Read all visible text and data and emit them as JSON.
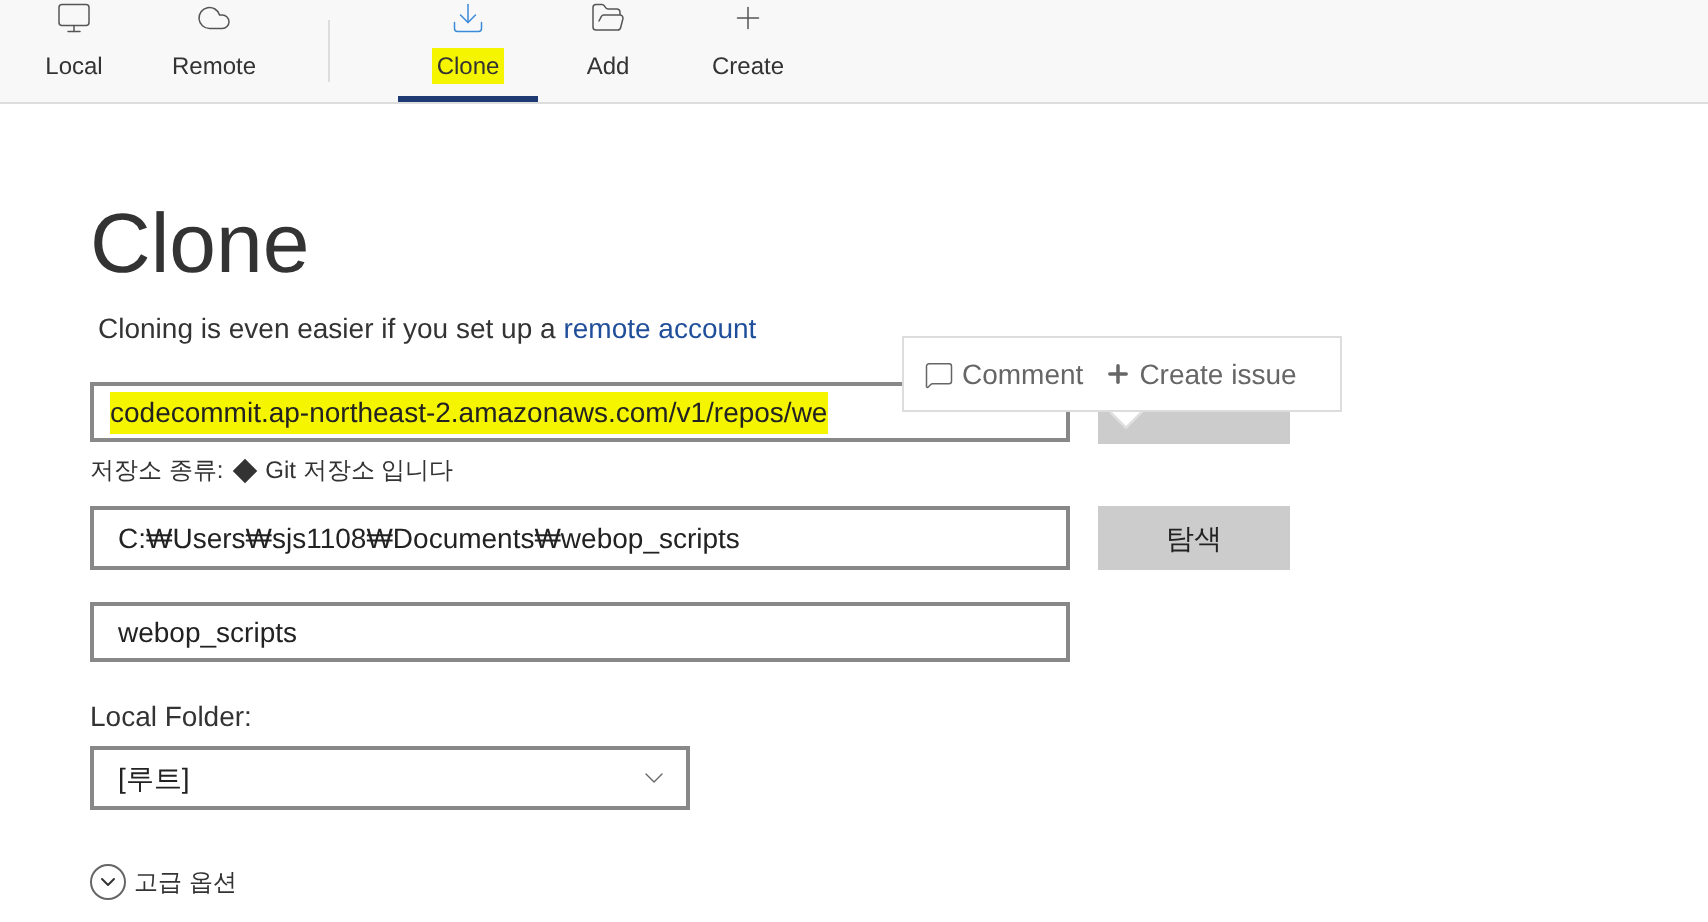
{
  "toolbar": {
    "items": [
      {
        "label": "Local",
        "selected": false
      },
      {
        "label": "Remote",
        "selected": false
      },
      {
        "label": "Clone",
        "selected": true
      },
      {
        "label": "Add",
        "selected": false
      },
      {
        "label": "Create",
        "selected": false
      }
    ]
  },
  "page": {
    "title": "Clone",
    "subtitle": "Cloning is even easier if you set up a",
    "subtitle_link": "remote account"
  },
  "source": {
    "value": "codecommit.ap-northeast-2.amazonaws.com/v1/repos/we",
    "hint": "저장소 종류:",
    "hint_type": "Git 저장소 입니다"
  },
  "destination": {
    "value": "C:₩Users₩sjs1108₩Documents₩webop_scripts",
    "button": "탐색"
  },
  "name": {
    "value": "webop_scripts"
  },
  "local_folder": {
    "label": "Local Folder:",
    "value": "[루트]"
  },
  "advanced": {
    "label": "고급 옵션",
    "expanded": false
  },
  "popup": {
    "comment": "Comment",
    "create_issue": "Create issue"
  }
}
